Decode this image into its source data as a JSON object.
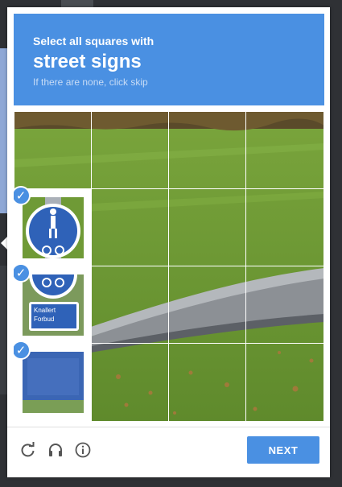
{
  "header": {
    "instruction": "Select all squares with",
    "target": "street signs",
    "hint": "If there are none, click skip"
  },
  "grid": {
    "rows": 4,
    "columns": 4,
    "selected_tiles": [
      {
        "row": 2,
        "column": 1
      },
      {
        "row": 3,
        "column": 1
      },
      {
        "row": 4,
        "column": 1
      }
    ],
    "sign_text": [
      "Knallert",
      "Forbud"
    ]
  },
  "footer": {
    "reload_icon": "reload-icon",
    "audio_icon": "headphones-icon",
    "info_icon": "info-icon",
    "next_label": "NEXT"
  },
  "colors": {
    "accent": "#4a90e2",
    "grass": "#6f9a36",
    "path": "#8c9095"
  }
}
